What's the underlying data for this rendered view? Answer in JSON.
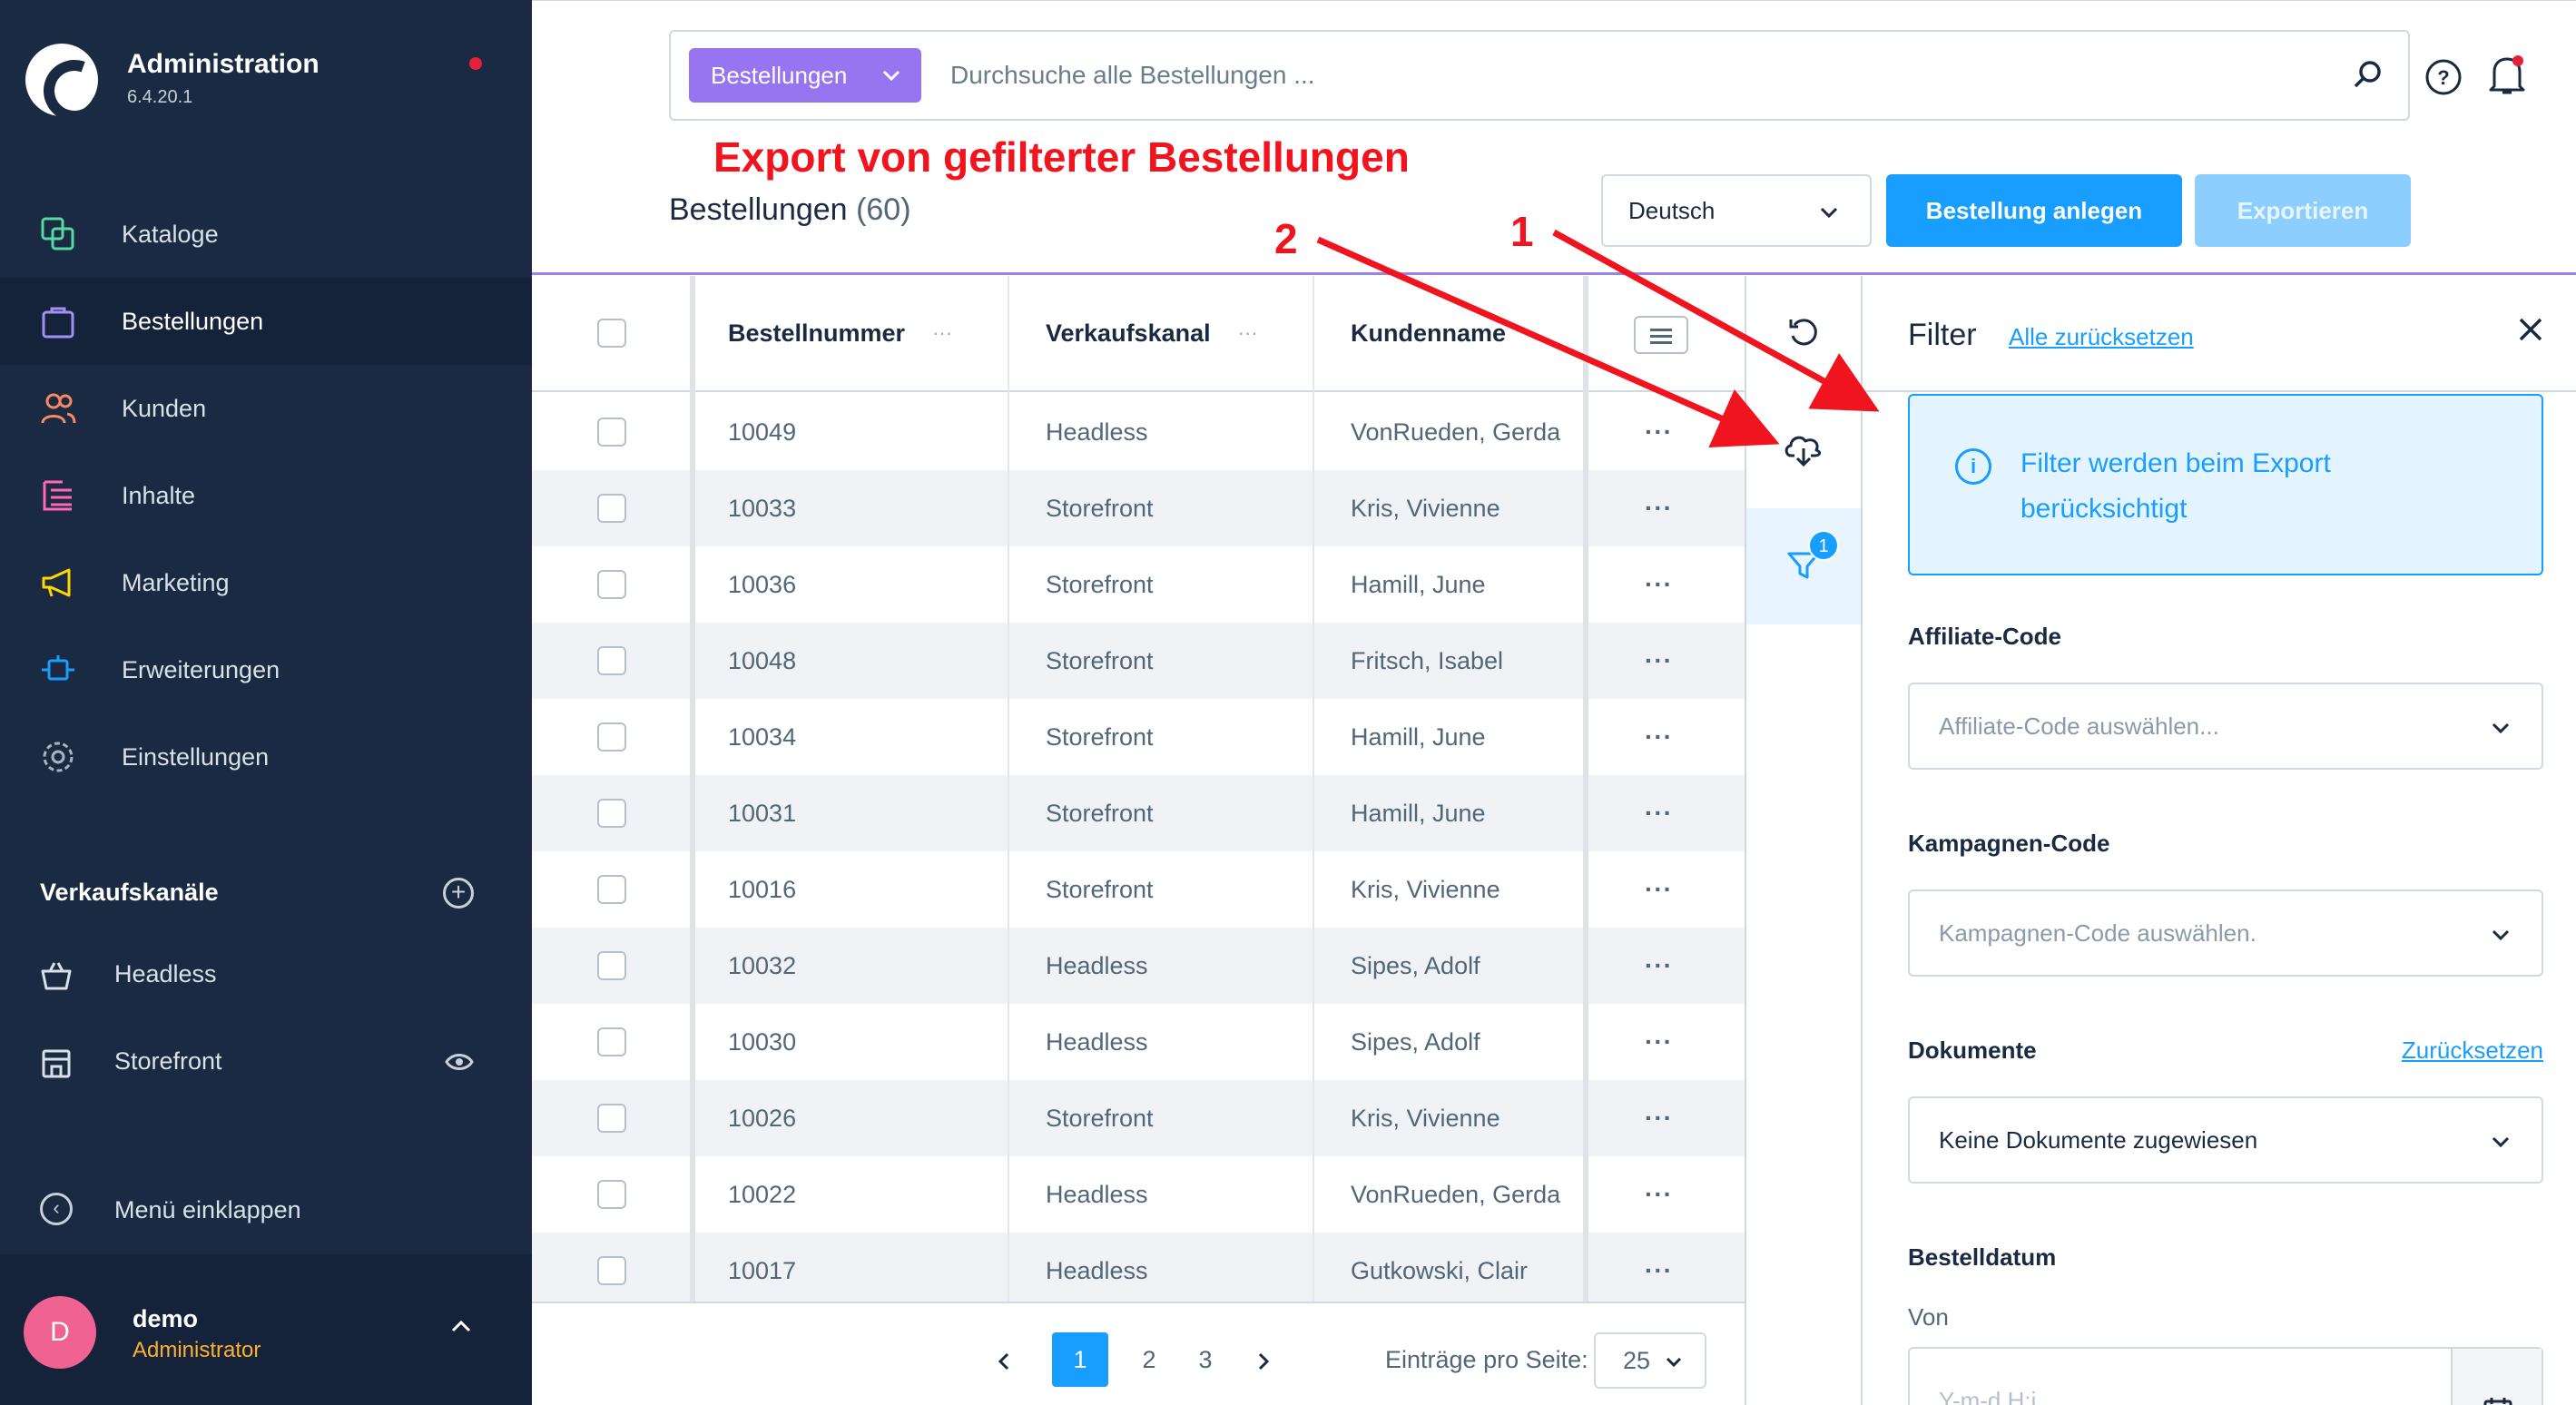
{
  "app": {
    "title": "Administration",
    "version": "6.4.20.1"
  },
  "nav": {
    "items": [
      {
        "label": "Kataloge",
        "icon": "catalog-icon"
      },
      {
        "label": "Bestellungen",
        "icon": "orders-icon",
        "active": true
      },
      {
        "label": "Kunden",
        "icon": "customers-icon"
      },
      {
        "label": "Inhalte",
        "icon": "content-icon"
      },
      {
        "label": "Marketing",
        "icon": "marketing-icon"
      },
      {
        "label": "Erweiterungen",
        "icon": "extensions-icon"
      },
      {
        "label": "Einstellungen",
        "icon": "settings-icon"
      }
    ],
    "channels_title": "Verkaufskanäle",
    "channels": [
      {
        "label": "Headless",
        "icon": "basket-icon"
      },
      {
        "label": "Storefront",
        "icon": "storefront-icon"
      }
    ],
    "collapse_label": "Menü einklappen"
  },
  "user": {
    "initial": "D",
    "name": "demo",
    "role": "Administrator"
  },
  "search": {
    "type_label": "Bestellungen",
    "placeholder": "Durchsuche alle Bestellungen ..."
  },
  "annotation": {
    "title": "Export von gefilterter Bestellungen",
    "marker_1": "1",
    "marker_2": "2"
  },
  "page": {
    "title": "Bestellungen",
    "count": "(60)",
    "language": "Deutsch",
    "create_button": "Bestellung anlegen",
    "export_button": "Exportieren"
  },
  "table": {
    "headers": {
      "order_number": "Bestellnummer",
      "sales_channel": "Verkaufskanal",
      "customer_name": "Kundenname"
    },
    "rows": [
      {
        "order": "10049",
        "channel": "Headless",
        "customer": "VonRueden, Gerda"
      },
      {
        "order": "10033",
        "channel": "Storefront",
        "customer": "Kris, Vivienne"
      },
      {
        "order": "10036",
        "channel": "Storefront",
        "customer": "Hamill, June"
      },
      {
        "order": "10048",
        "channel": "Storefront",
        "customer": "Fritsch, Isabel"
      },
      {
        "order": "10034",
        "channel": "Storefront",
        "customer": "Hamill, June"
      },
      {
        "order": "10031",
        "channel": "Storefront",
        "customer": "Hamill, June"
      },
      {
        "order": "10016",
        "channel": "Storefront",
        "customer": "Kris, Vivienne"
      },
      {
        "order": "10032",
        "channel": "Headless",
        "customer": "Sipes, Adolf"
      },
      {
        "order": "10030",
        "channel": "Headless",
        "customer": "Sipes, Adolf"
      },
      {
        "order": "10026",
        "channel": "Storefront",
        "customer": "Kris, Vivienne"
      },
      {
        "order": "10022",
        "channel": "Headless",
        "customer": "VonRueden, Gerda"
      },
      {
        "order": "10017",
        "channel": "Headless",
        "customer": "Gutkowski, Clair"
      }
    ],
    "row_menu": "···"
  },
  "pagination": {
    "prev": "‹",
    "next": "›",
    "pages": [
      "1",
      "2",
      "3"
    ],
    "active_page": "1",
    "per_page_label": "Einträge pro Seite:",
    "per_page_value": "25"
  },
  "tools": {
    "filter_badge": "1"
  },
  "filter": {
    "title": "Filter",
    "reset_all": "Alle zurücksetzen",
    "info": "Filter werden beim Export berücksichtigt",
    "affiliate_label": "Affiliate-Code",
    "affiliate_placeholder": "Affiliate-Code auswählen...",
    "campaign_label": "Kampagnen-Code",
    "campaign_placeholder": "Kampagnen-Code auswählen.",
    "documents_label": "Dokumente",
    "documents_reset": "Zurücksetzen",
    "documents_value": "Keine Dokumente zugewiesen",
    "order_date_label": "Bestelldatum",
    "from_label": "Von",
    "from_placeholder": "Y-m-d H:i"
  },
  "colors": {
    "sidebar": "#1a2a42",
    "primary": "#189eff",
    "search_type": "#9775f0",
    "annotation": "#f0141e",
    "role": "#ffb02e"
  }
}
